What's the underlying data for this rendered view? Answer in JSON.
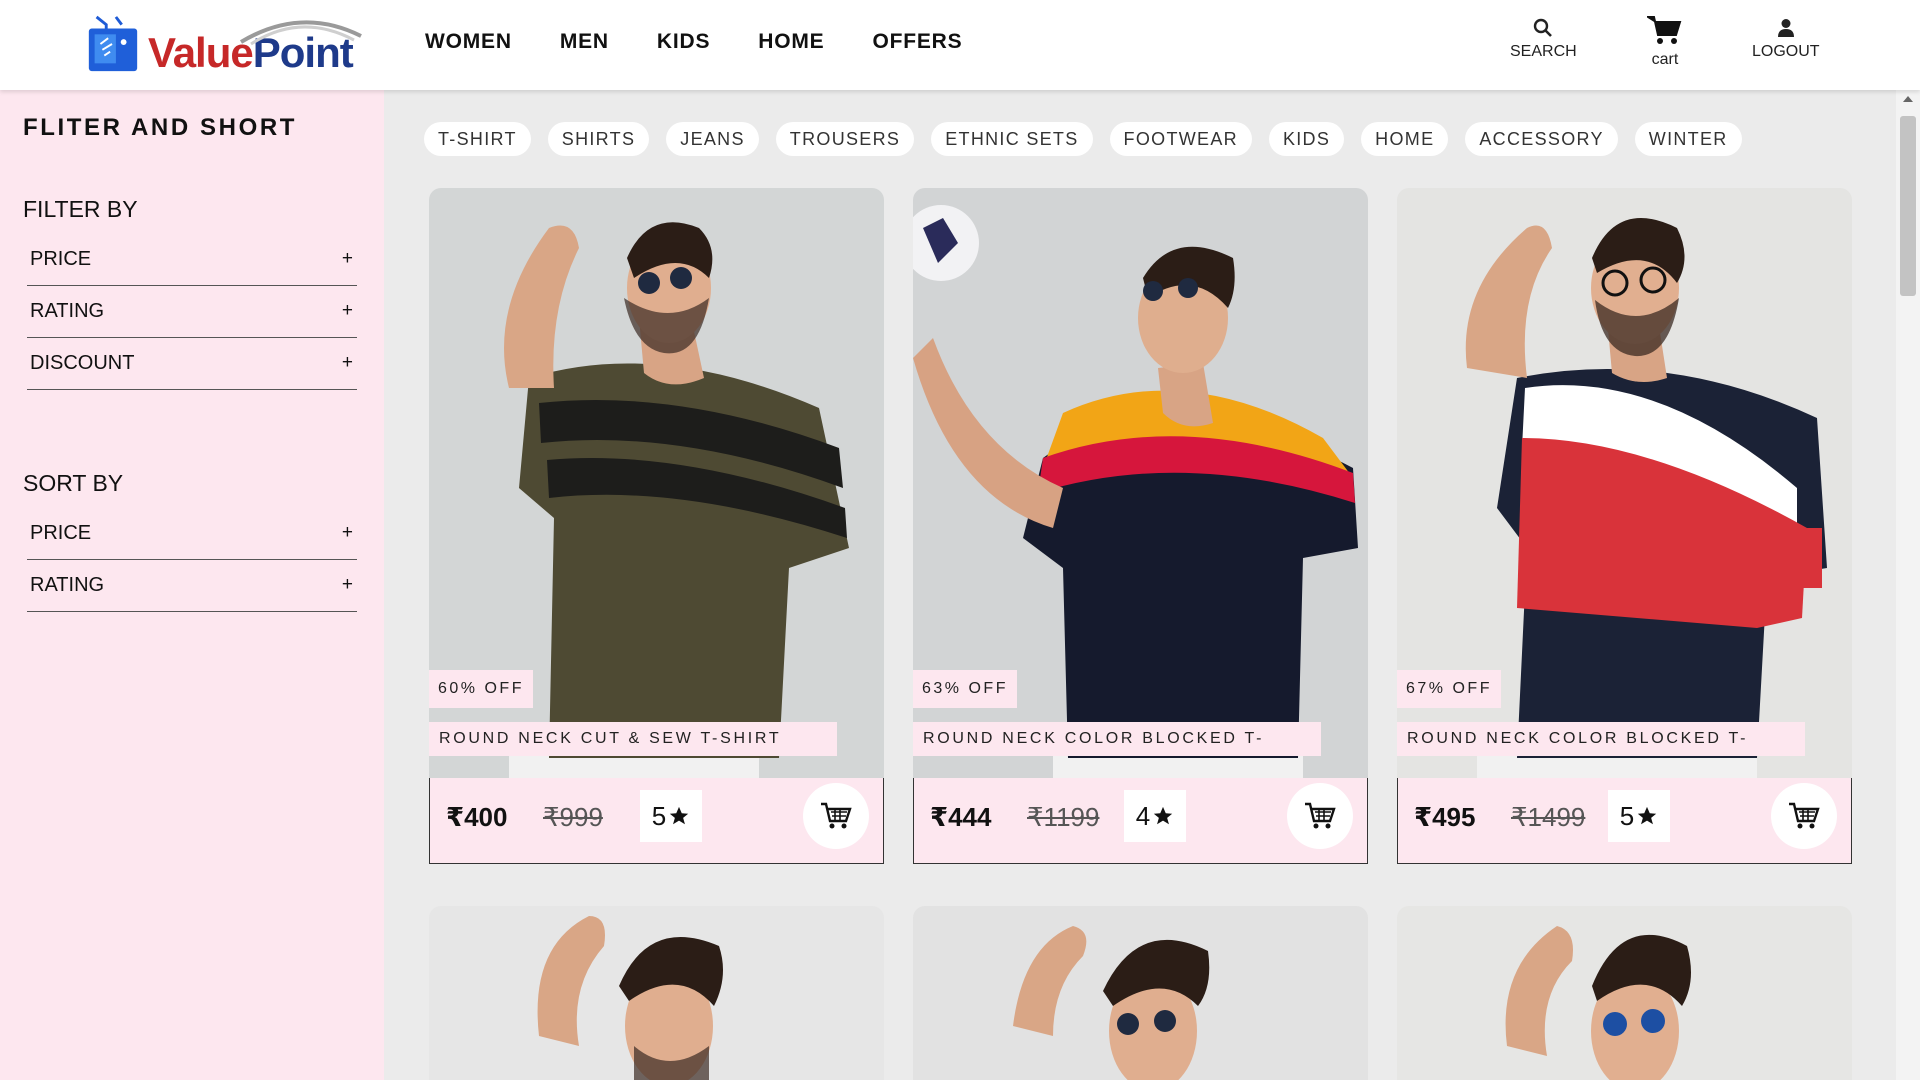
{
  "header": {
    "logo": {
      "text_value": "Value",
      "text_point": "Point"
    },
    "nav": [
      "WOMEN",
      "MEN",
      "KIDS",
      "HOME",
      "OFFERS"
    ],
    "icons": [
      {
        "label": "SEARCH",
        "icon": "search-icon"
      },
      {
        "label": "cart",
        "icon": "cart-icon"
      },
      {
        "label": "LOGOUT",
        "icon": "user-icon"
      }
    ]
  },
  "sidebar": {
    "title": "FLITER AND SHORT",
    "filter_heading": "FILTER BY",
    "filters": [
      "PRICE",
      "RATING",
      "DISCOUNT"
    ],
    "sort_heading": "SORT BY",
    "sorts": [
      "PRICE",
      "RATING"
    ],
    "expand_symbol": "+"
  },
  "categories": [
    "T-SHIRT",
    "SHIRTS",
    "JEANS",
    "TROUSERS",
    "ETHNIC SETS",
    "FOOTWEAR",
    "KIDS",
    "HOME",
    "ACCESSORY",
    "WINTER"
  ],
  "products": [
    {
      "discount": "60% OFF",
      "name": "ROUND NECK CUT & SEW T-SHIRT",
      "price": "₹400",
      "mrp": "₹999",
      "rating": "5",
      "colors": {
        "shirt": "#4e4a33",
        "stripe": "#1d1d1b"
      }
    },
    {
      "discount": "63% OFF",
      "name": "ROUND NECK COLOR BLOCKED T-",
      "price": "₹444",
      "mrp": "₹1199",
      "rating": "4",
      "colors": {
        "top": "#f2a516",
        "mid": "#d6163c",
        "shirt": "#151a2d"
      }
    },
    {
      "discount": "67% OFF",
      "name": "ROUND NECK COLOR BLOCKED T-",
      "price": "₹495",
      "mrp": "₹1499",
      "rating": "5",
      "colors": {
        "top": "#1b2236",
        "white": "#ffffff",
        "red": "#d9333a",
        "bottom": "#171d30"
      }
    }
  ],
  "colors": {
    "sidebar_bg": "#fde7ef",
    "page_bg": "#ebebeb",
    "logo_red": "#c62828",
    "logo_blue": "#1e3a8a"
  }
}
